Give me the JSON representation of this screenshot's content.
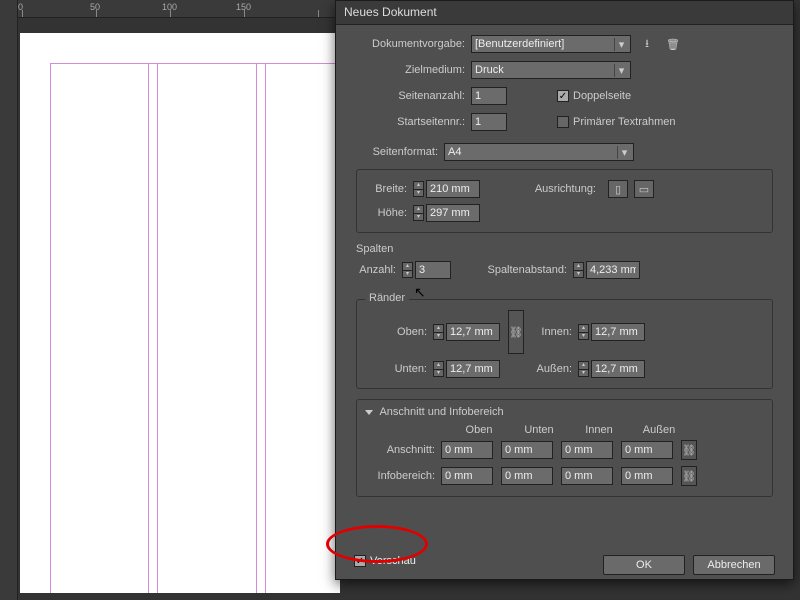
{
  "ruler": {
    "m0": "0",
    "m50": "50",
    "m100": "100",
    "m150": "150"
  },
  "dialog": {
    "title": "Neues Dokument",
    "preset_label": "Dokumentvorgabe:",
    "preset_value": "[Benutzerdefiniert]",
    "intent_label": "Zielmedium:",
    "intent_value": "Druck",
    "pages_label": "Seitenanzahl:",
    "pages_value": "1",
    "facing_label": "Doppelseite",
    "startpage_label": "Startseitennr.:",
    "startpage_value": "1",
    "primaryframe_label": "Primärer Textrahmen",
    "pagesize_label": "Seitenformat:",
    "pagesize_value": "A4",
    "width_label": "Breite:",
    "width_value": "210 mm",
    "height_label": "Höhe:",
    "height_value": "297 mm",
    "orient_label": "Ausrichtung:",
    "columns": {
      "title": "Spalten",
      "count_label": "Anzahl:",
      "count_value": "3",
      "gutter_label": "Spaltenabstand:",
      "gutter_value": "4,233 mm"
    },
    "margins": {
      "title": "Ränder",
      "top_label": "Oben:",
      "top_value": "12,7 mm",
      "bottom_label": "Unten:",
      "bottom_value": "12,7 mm",
      "inside_label": "Innen:",
      "inside_value": "12,7 mm",
      "outside_label": "Außen:",
      "outside_value": "12,7 mm"
    },
    "bleed": {
      "title": "Anschnitt und Infobereich",
      "hdr_top": "Oben",
      "hdr_bottom": "Unten",
      "hdr_inside": "Innen",
      "hdr_outside": "Außen",
      "bleed_label": "Anschnitt:",
      "bleed_v": "0 mm",
      "slug_label": "Infobereich:",
      "slug_v": "0 mm"
    },
    "preview_label": "Vorschau",
    "ok": "OK",
    "cancel": "Abbrechen"
  }
}
